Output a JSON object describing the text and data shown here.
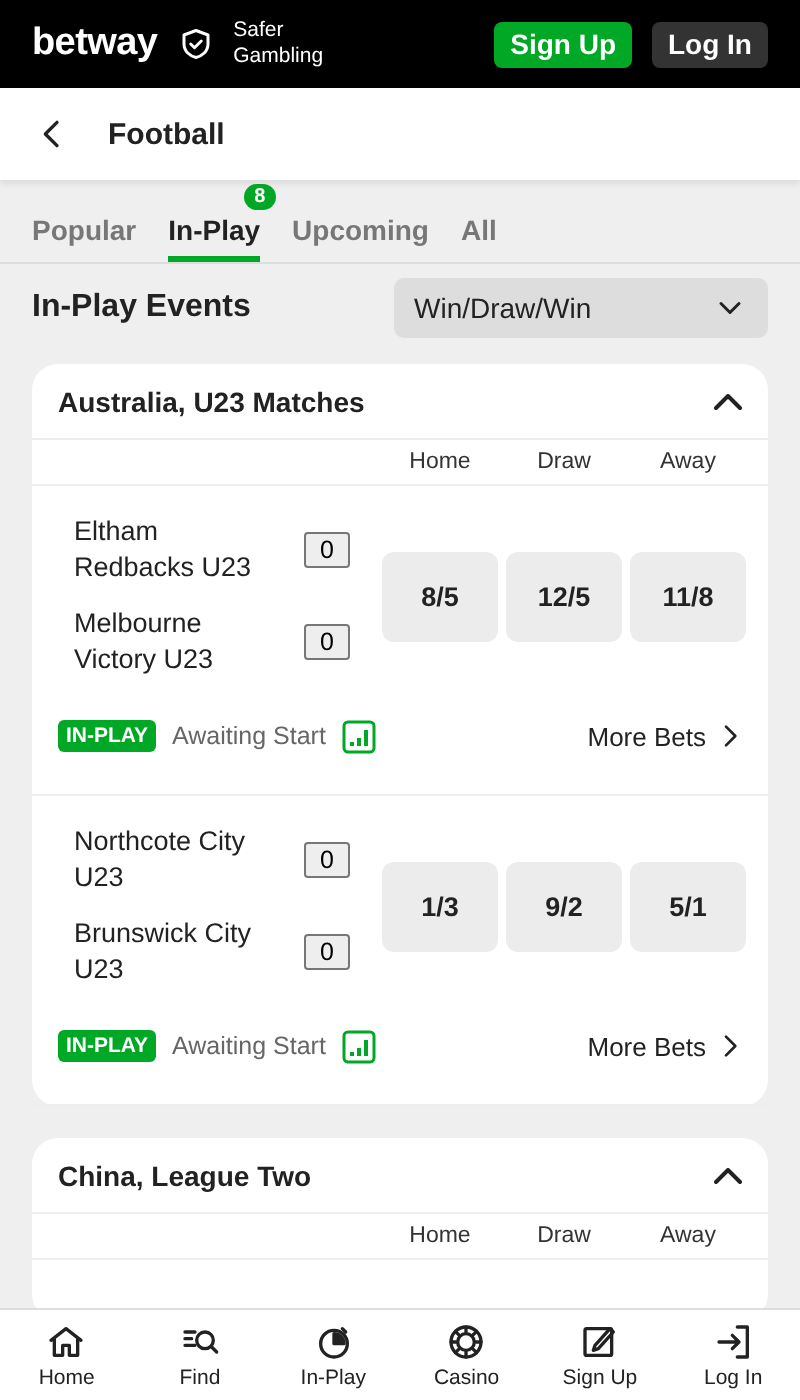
{
  "header": {
    "brand": "betway",
    "safer": [
      "Safer",
      "Gambling"
    ],
    "buttons": [
      {
        "label": "Sign Up",
        "kind": "primary"
      },
      {
        "label": "Log In",
        "kind": "secondary"
      }
    ]
  },
  "page": {
    "title": "Football"
  },
  "tabs": [
    {
      "label": "Popular",
      "selected": false
    },
    {
      "label": "In-Play",
      "selected": true,
      "badge": "8"
    },
    {
      "label": "Upcoming",
      "selected": false
    },
    {
      "label": "All",
      "selected": false
    }
  ],
  "section": {
    "title": "In-Play Events",
    "market": "Win/Draw/Win"
  },
  "competitions": [
    {
      "name": "Australia, U23 Matches",
      "expanded": true,
      "columns": [
        "Home",
        "Draw",
        "Away"
      ],
      "matches": [
        {
          "teams": [
            {
              "name": "Eltham Redbacks U23",
              "score": "0"
            },
            {
              "name": "Melbourne Victory U23",
              "score": "0"
            }
          ],
          "odds": [
            "8/5",
            "12/5",
            "11/8"
          ],
          "badge": "IN-PLAY",
          "status": "Awaiting Start",
          "more": "More Bets"
        },
        {
          "teams": [
            {
              "name": "Northcote City U23",
              "score": "0"
            },
            {
              "name": "Brunswick City U23",
              "score": "0"
            }
          ],
          "odds": [
            "1/3",
            "9/2",
            "5/1"
          ],
          "badge": "IN-PLAY",
          "status": "Awaiting Start",
          "more": "More Bets"
        }
      ]
    },
    {
      "name": "China, League Two",
      "expanded": true,
      "columns": [
        "Home",
        "Draw",
        "Away"
      ]
    }
  ],
  "nav": [
    {
      "label": "Home",
      "kind": "home"
    },
    {
      "label": "Find",
      "kind": "find"
    },
    {
      "label": "In-Play",
      "kind": "inplay"
    },
    {
      "label": "Casino",
      "kind": "casino"
    },
    {
      "label": "Sign Up",
      "kind": "signup"
    },
    {
      "label": "Log In",
      "kind": "login"
    }
  ]
}
